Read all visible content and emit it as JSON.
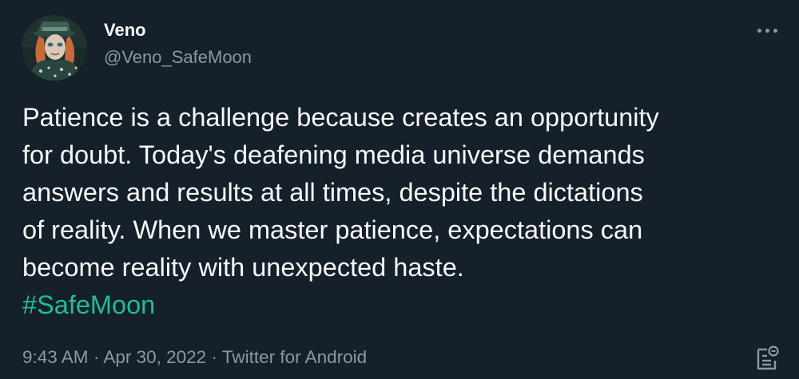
{
  "author": {
    "display_name": "Veno",
    "handle": "@Veno_SafeMoon"
  },
  "tweet": {
    "text": "Patience is a challenge because creates an opportunity\nfor doubt. Today's deafening media universe demands\nanswers and results at all times, despite the dictations\nof reality. When we master patience, expectations can\nbecome reality with unexpected haste.",
    "hashtag": "#SafeMoon"
  },
  "meta": {
    "time": "9:43 AM",
    "separator": "·",
    "date": "Apr 30, 2022",
    "source": "Twitter for Android"
  },
  "colors": {
    "background": "#15202b",
    "text_primary": "#f7f9f9",
    "text_secondary": "#8b98a5",
    "hashtag": "#1fbf8f"
  },
  "icons": {
    "more": "more-horizontal-icon",
    "notes": "tweet-notes-icon"
  }
}
